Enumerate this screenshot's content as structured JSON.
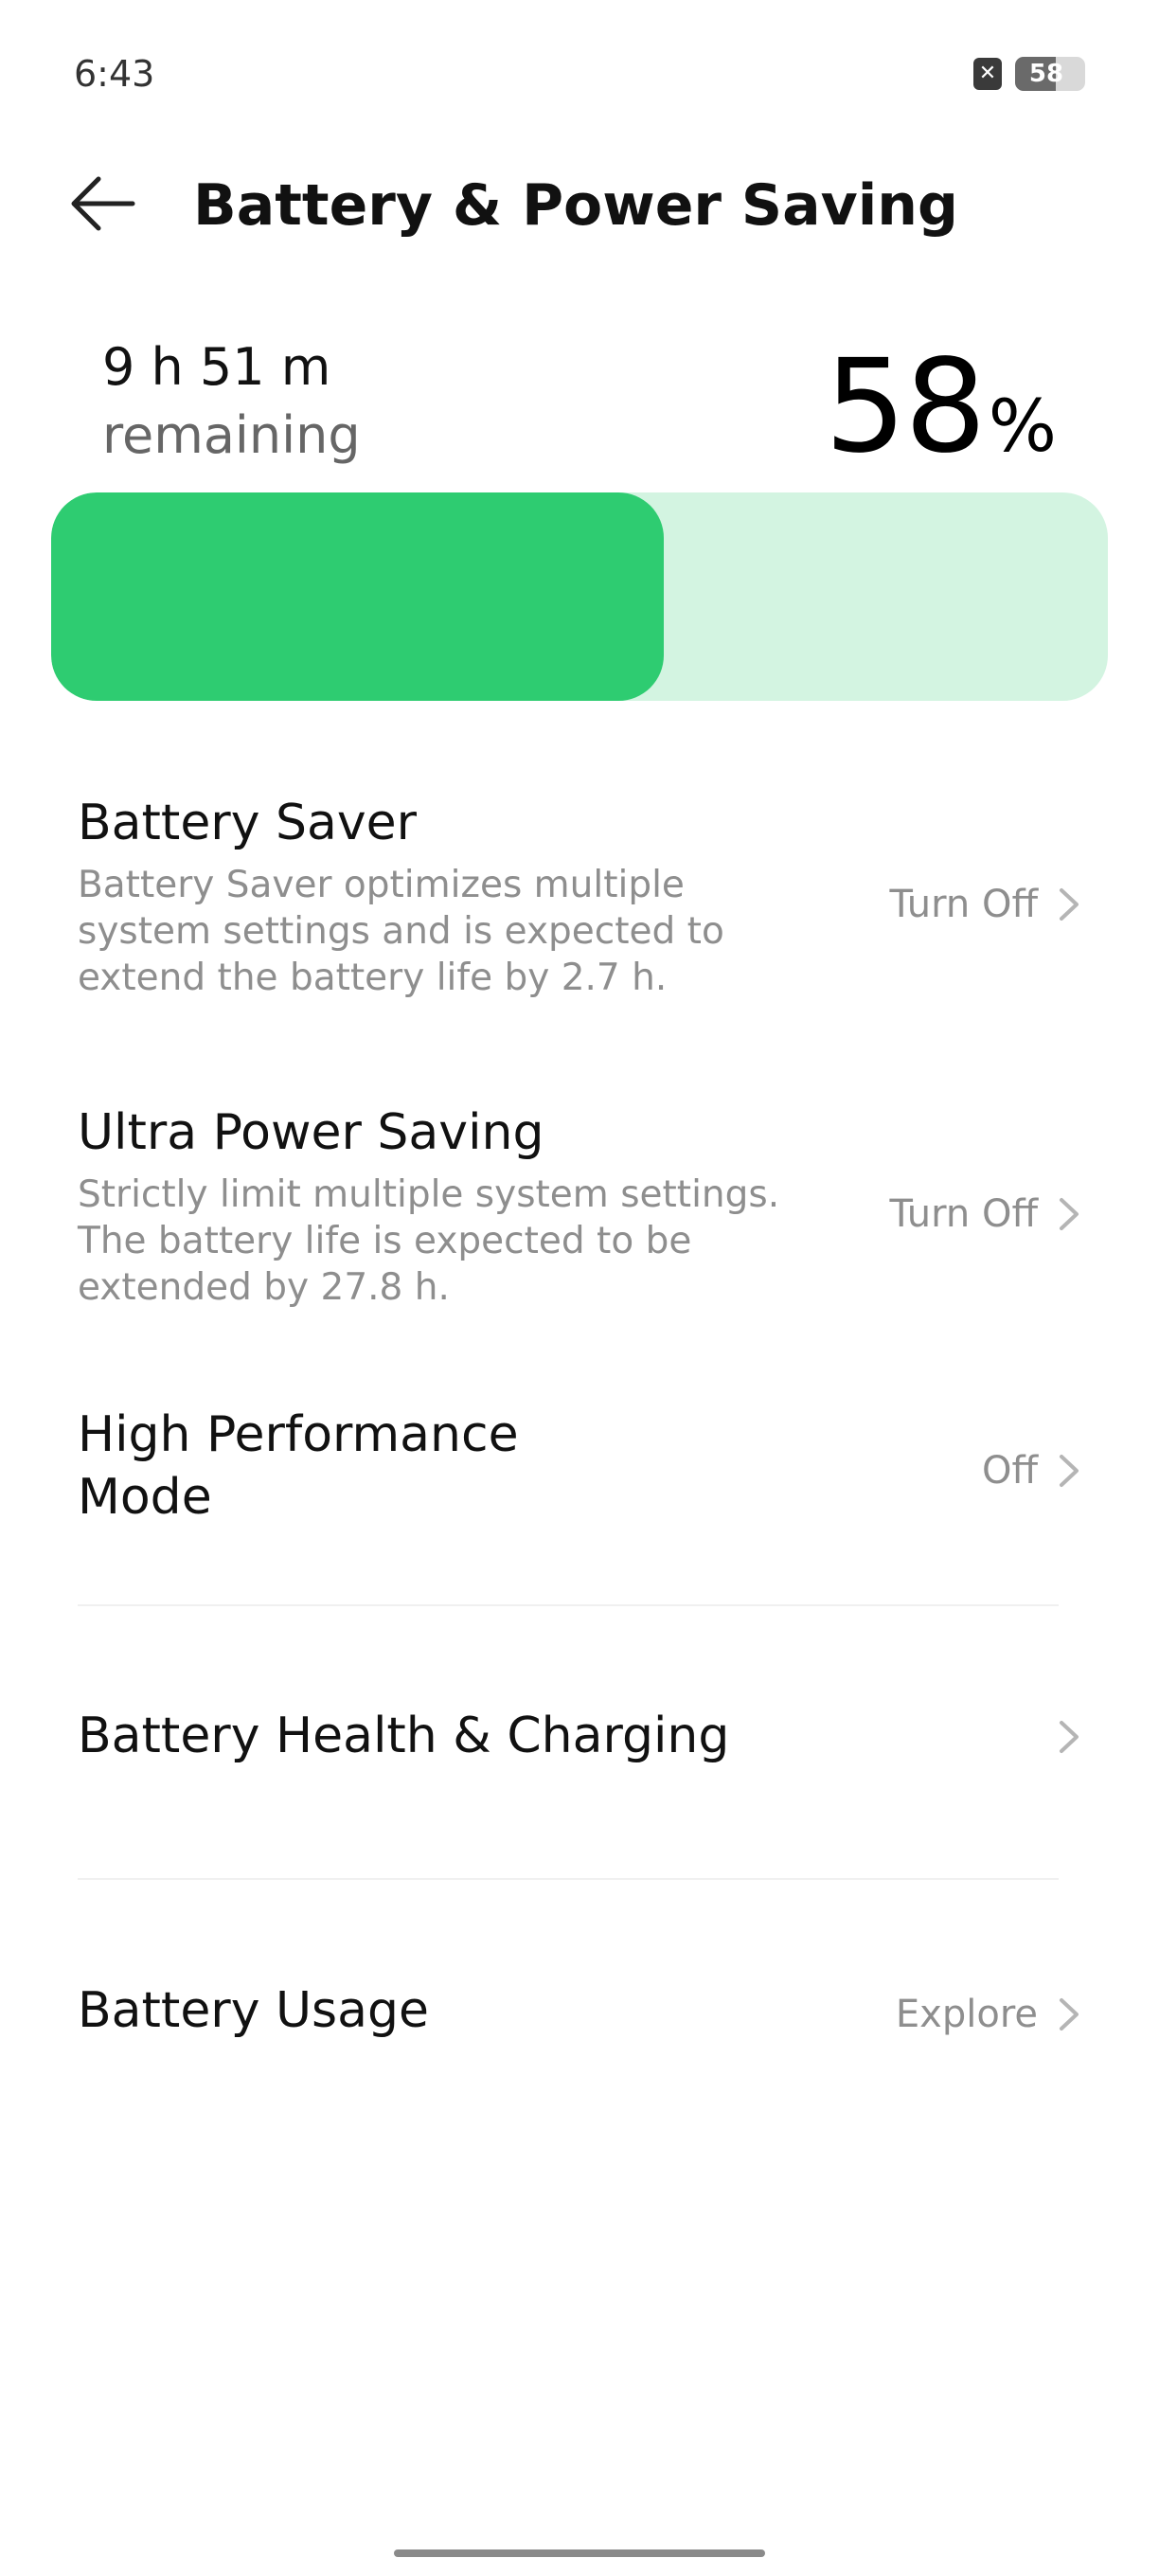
{
  "status_bar": {
    "time": "6:43",
    "sim_icon": "sim-blocked-icon",
    "battery_level_text": "58",
    "battery_level_fraction": 0.58
  },
  "header": {
    "title": "Battery & Power Saving",
    "back_icon": "arrow-left-icon"
  },
  "battery_summary": {
    "time_remaining": "9 h 51 m",
    "remaining_label": "remaining",
    "percent_value": "58",
    "percent_unit": "%",
    "fill_fraction": 0.58,
    "fill_color": "#2ecc71",
    "track_color": "#d3f4e1"
  },
  "list": {
    "battery_saver": {
      "title": "Battery Saver",
      "description": "Battery Saver optimizes multiple system settings and is expected to extend the battery life by 2.7 h.",
      "value": "Turn Off"
    },
    "ultra_power_saving": {
      "title": "Ultra Power Saving",
      "description": "Strictly limit multiple system settings. The battery life is expected to be extended by 27.8 h.",
      "value": "Turn Off"
    },
    "high_performance": {
      "title": "High Performance Mode",
      "value": "Off"
    },
    "battery_health": {
      "title": "Battery Health & Charging"
    },
    "battery_usage": {
      "title": "Battery Usage",
      "value": "Explore"
    }
  }
}
